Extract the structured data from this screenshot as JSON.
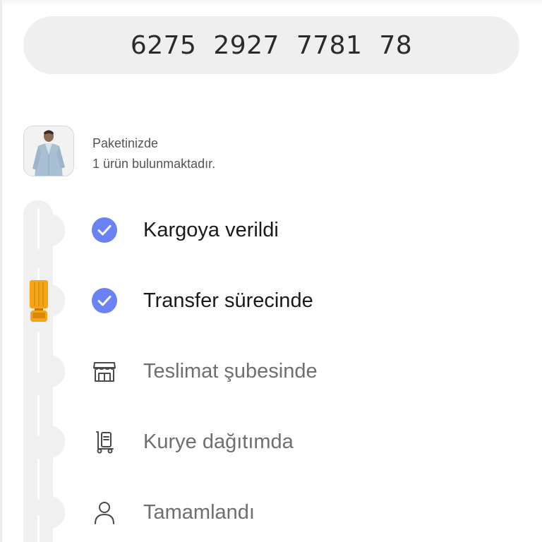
{
  "tracking": {
    "number": "6275  2927  7781  78"
  },
  "package": {
    "line1": "Paketinizde",
    "line2": "1 ürün bulunmaktadır.",
    "thumbnail": "product-photo-man-denim-shirt"
  },
  "steps": [
    {
      "label": "Kargoya verildi",
      "status": "done",
      "icon": "check-circle-icon"
    },
    {
      "label": "Transfer sürecinde",
      "status": "done",
      "icon": "check-circle-icon"
    },
    {
      "label": "Teslimat şubesinde",
      "status": "pending",
      "icon": "store-icon"
    },
    {
      "label": "Kurye dağıtımda",
      "status": "pending",
      "icon": "courier-cart-icon"
    },
    {
      "label": "Tamamlandı",
      "status": "pending",
      "icon": "user-icon"
    }
  ],
  "current_step": "Transfer sürecinde",
  "colors": {
    "check_blue": "#6b82f5",
    "truck_orange": "#f5a516",
    "road_gray": "#f0f0f0"
  }
}
